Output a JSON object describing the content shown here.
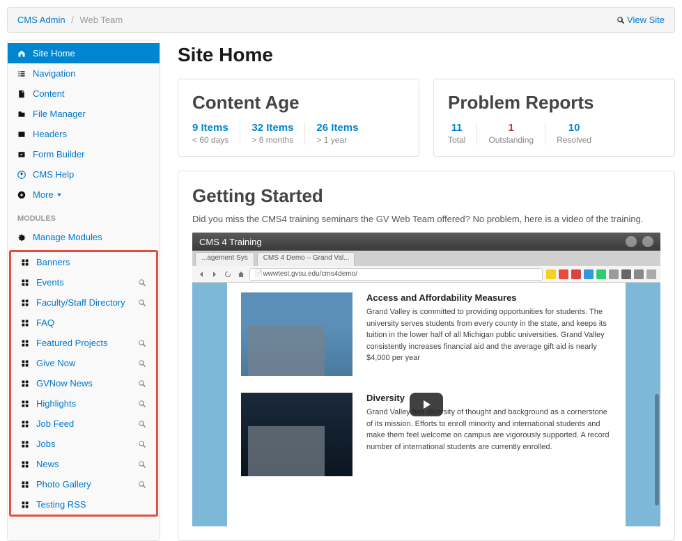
{
  "breadcrumb": {
    "root": "CMS Admin",
    "current": "Web Team"
  },
  "view_site": "View Site",
  "sidebar": {
    "main_items": [
      {
        "label": "Site Home",
        "active": true,
        "icon": "home"
      },
      {
        "label": "Navigation",
        "active": false,
        "icon": "list"
      },
      {
        "label": "Content",
        "active": false,
        "icon": "file"
      },
      {
        "label": "File Manager",
        "active": false,
        "icon": "folder"
      },
      {
        "label": "Headers",
        "active": false,
        "icon": "image"
      },
      {
        "label": "Form Builder",
        "active": false,
        "icon": "check"
      },
      {
        "label": "CMS Help",
        "active": false,
        "icon": "help"
      },
      {
        "label": "More",
        "active": false,
        "icon": "plus",
        "chevron": true
      }
    ],
    "modules_header": "MODULES",
    "manage_modules": "Manage Modules",
    "module_items": [
      {
        "label": "Banners",
        "search": false
      },
      {
        "label": "Events",
        "search": true
      },
      {
        "label": "Faculty/Staff Directory",
        "search": true
      },
      {
        "label": "FAQ",
        "search": false
      },
      {
        "label": "Featured Projects",
        "search": true
      },
      {
        "label": "Give Now",
        "search": true
      },
      {
        "label": "GVNow News",
        "search": true
      },
      {
        "label": "Highlights",
        "search": true
      },
      {
        "label": "Job Feed",
        "search": true
      },
      {
        "label": "Jobs",
        "search": true
      },
      {
        "label": "News",
        "search": true
      },
      {
        "label": "Photo Gallery",
        "search": true
      },
      {
        "label": "Testing RSS",
        "search": false
      }
    ]
  },
  "page_title": "Site Home",
  "content_age": {
    "title": "Content Age",
    "stats": [
      {
        "value": "9 Items",
        "sub": "< 60 days"
      },
      {
        "value": "32 Items",
        "sub": "> 6 months"
      },
      {
        "value": "26 Items",
        "sub": "> 1 year"
      }
    ]
  },
  "problem_reports": {
    "title": "Problem Reports",
    "stats": [
      {
        "value": "11",
        "sub": "Total",
        "color": "blue"
      },
      {
        "value": "1",
        "sub": "Outstanding",
        "color": "red"
      },
      {
        "value": "10",
        "sub": "Resolved",
        "color": "blue"
      }
    ]
  },
  "getting_started": {
    "title": "Getting Started",
    "text": "Did you miss the CMS4 training seminars the GV Web Team offered? No problem, here is a video of the training."
  },
  "video": {
    "title": "CMS 4 Training",
    "tabs": [
      "...agement Sys",
      "CMS 4 Demo – Grand Val..."
    ],
    "url": "wwwtest.gvsu.edu/cms4demo/",
    "articles": [
      {
        "title": "Access and Affordability Measures",
        "body": "Grand Valley is committed to providing opportunities for students. The university serves students from every county in the state, and keeps its tuition in the lower half of all Michigan public universities. Grand Valley consistently increases financial aid and the average gift aid is nearly $4,000 per year"
      },
      {
        "title": "Diversity",
        "body": "Grand Valley has diversity of thought and background as a cornerstone of its mission. Efforts to enroll minority and international students and make them feel welcome on campus are vigorously supported. A record number of international students are currently enrolled."
      }
    ]
  }
}
